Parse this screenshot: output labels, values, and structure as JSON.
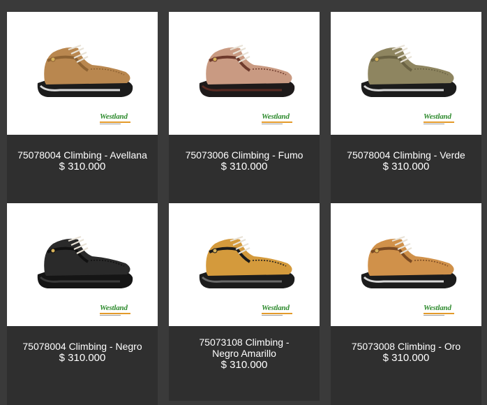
{
  "products": [
    {
      "title": "75078004 Climbing - Avellana",
      "price": "$ 310.000",
      "brand": "Westland",
      "colors": {
        "upper": "#b9874f",
        "upper_dark": "#8e6333",
        "sole": "#1c1c1c",
        "sole_stripe": "#d8d8d8"
      }
    },
    {
      "title": "75073006 Climbing - Fumo",
      "price": "$ 310.000",
      "brand": "Westland",
      "colors": {
        "upper": "#c99a82",
        "upper_dark": "#6e3a2c",
        "sole": "#1e1a1a",
        "sole_stripe": "#5a2a22"
      }
    },
    {
      "title": "75078004 Climbing - Verde",
      "price": "$ 310.000",
      "brand": "Westland",
      "colors": {
        "upper": "#8e8560",
        "upper_dark": "#6b6344",
        "sole": "#1c1c1c",
        "sole_stripe": "#d8d8d8"
      }
    },
    {
      "title": "75078004 Climbing - Negro",
      "price": "$ 310.000",
      "brand": "Westland",
      "colors": {
        "upper": "#2a2a2a",
        "upper_dark": "#111111",
        "sole": "#151515",
        "sole_stripe": "#3a3a3a"
      }
    },
    {
      "title": "75073108 Climbing - Negro Amarillo",
      "price": "$ 310.000",
      "brand": "Westland",
      "colors": {
        "upper": "#d49a3c",
        "upper_dark": "#1a1a1a",
        "sole": "#1c1c1c",
        "sole_stripe": "#6a6a6a"
      }
    },
    {
      "title": "75073008 Climbing - Oro",
      "price": "$ 310.000",
      "brand": "Westland",
      "colors": {
        "upper": "#d0914a",
        "upper_dark": "#7a4a22",
        "sole": "#1c1c1c",
        "sole_stripe": "#d8d8d8"
      }
    }
  ]
}
